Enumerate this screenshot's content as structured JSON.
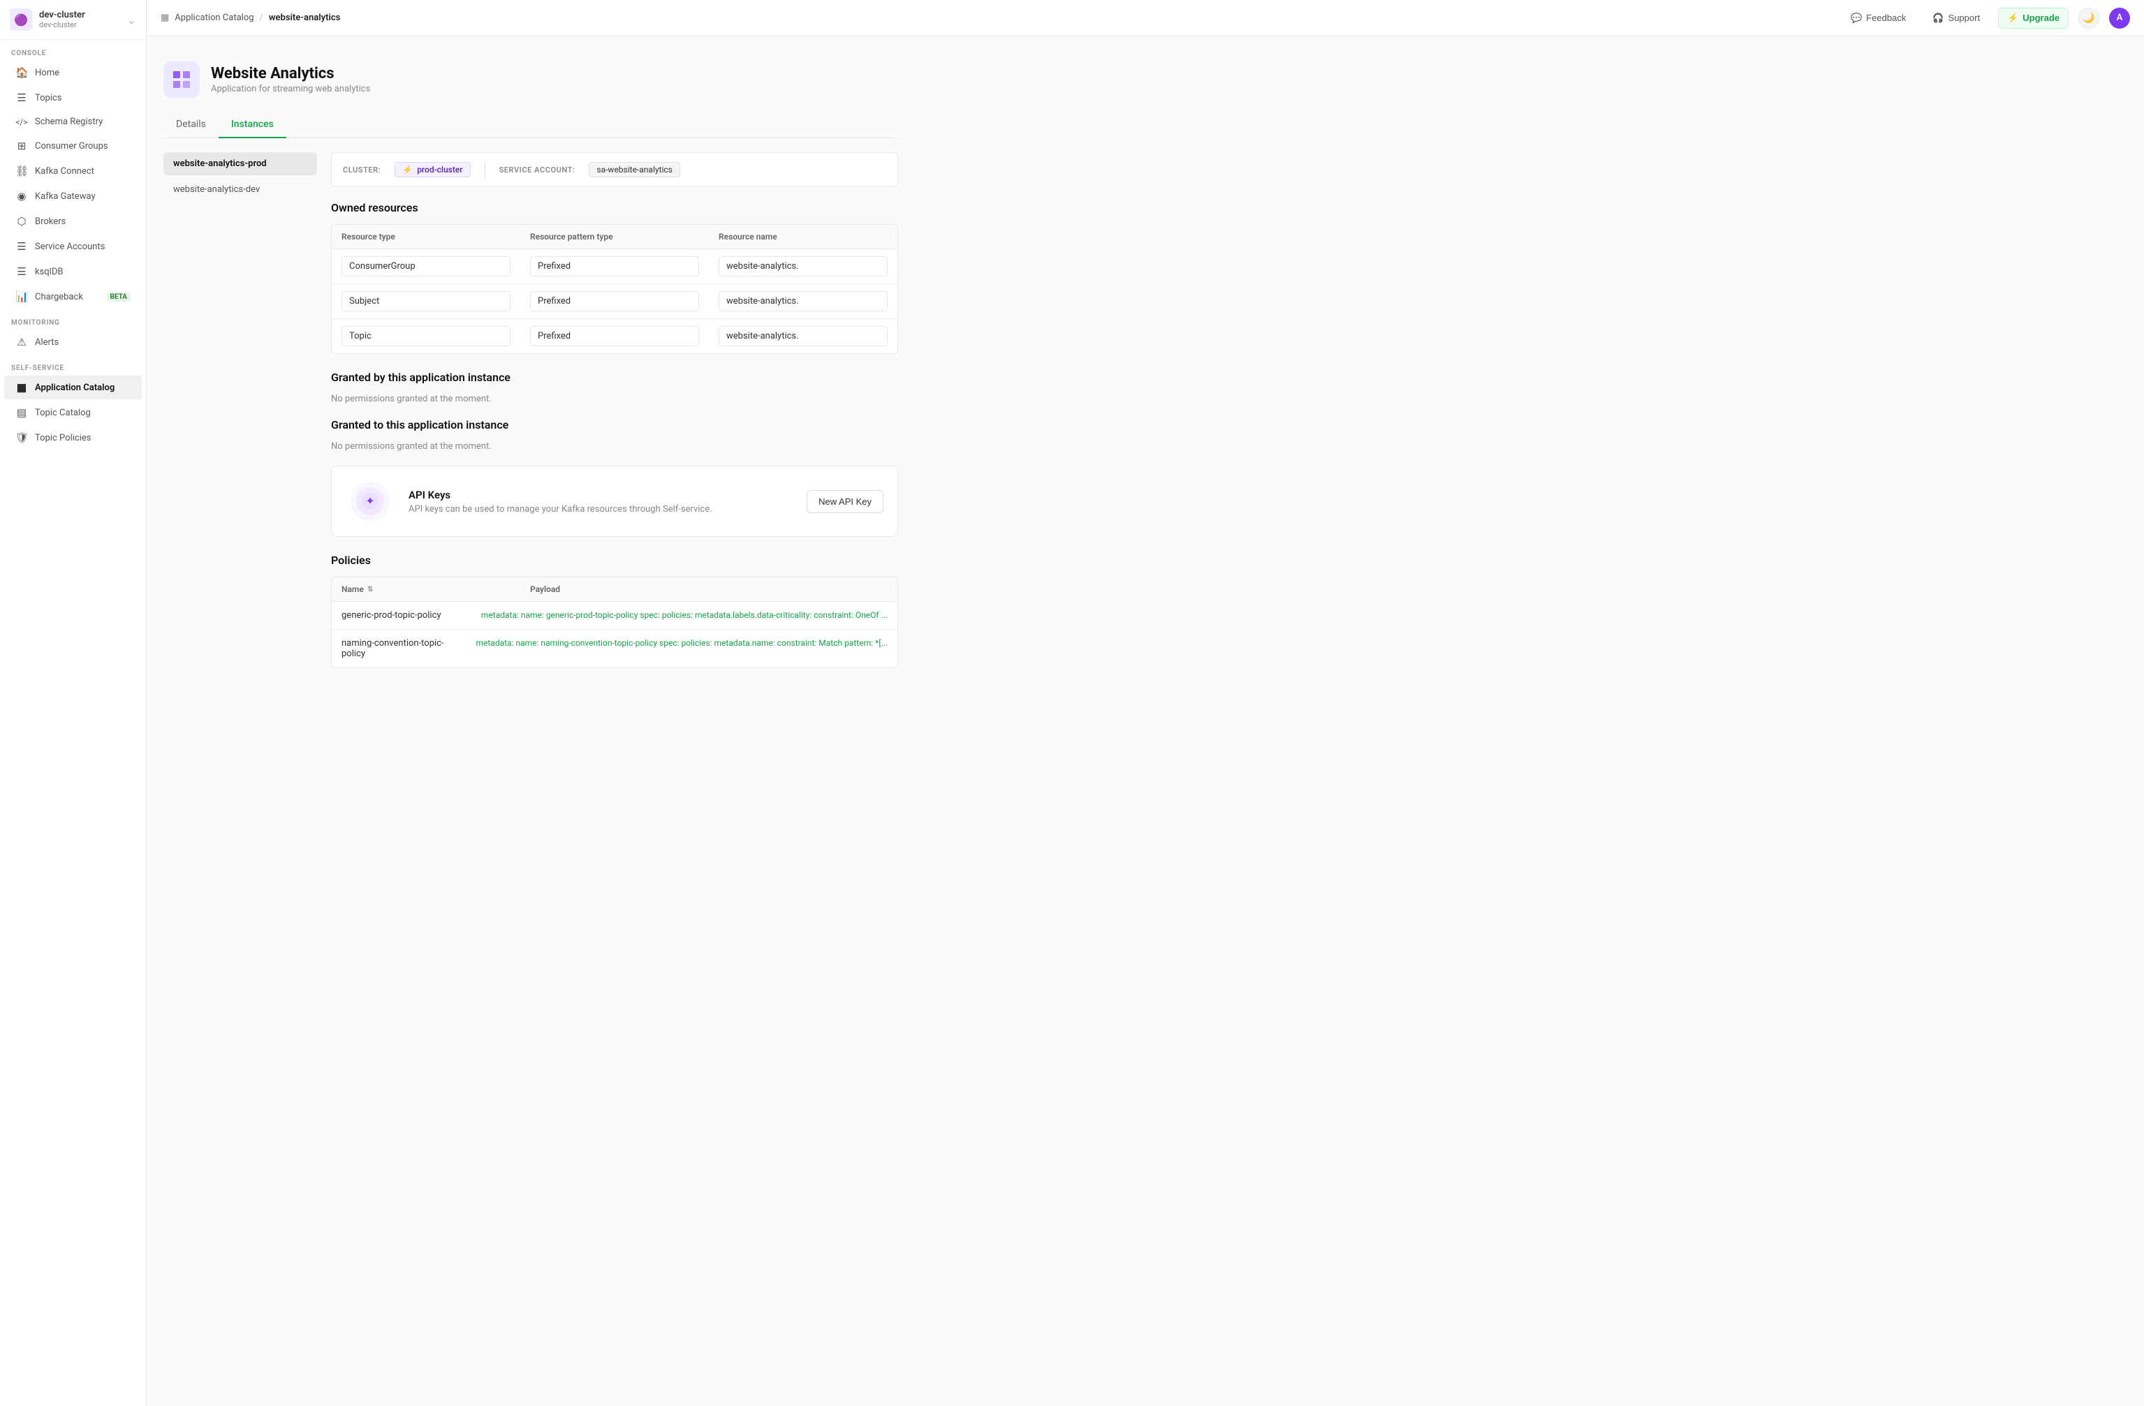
{
  "sidebar": {
    "cluster": {
      "name": "dev-cluster",
      "sub": "dev-cluster"
    },
    "console_label": "CONSOLE",
    "monitoring_label": "MONITORING",
    "selfservice_label": "SELF-SERVICE",
    "items_console": [
      {
        "id": "home",
        "label": "Home",
        "icon": "🏠"
      },
      {
        "id": "topics",
        "label": "Topics",
        "icon": "☰"
      },
      {
        "id": "schema-registry",
        "label": "Schema Registry",
        "icon": "⟨⟩"
      },
      {
        "id": "consumer-groups",
        "label": "Consumer Groups",
        "icon": "👥"
      },
      {
        "id": "kafka-connect",
        "label": "Kafka Connect",
        "icon": "⛓"
      },
      {
        "id": "kafka-gateway",
        "label": "Kafka Gateway",
        "icon": "⊙"
      },
      {
        "id": "brokers",
        "label": "Brokers",
        "icon": "⬡"
      },
      {
        "id": "service-accounts",
        "label": "Service Accounts",
        "icon": "☰"
      },
      {
        "id": "ksqldb",
        "label": "ksqlDB",
        "icon": "☰"
      },
      {
        "id": "chargeback",
        "label": "Chargeback",
        "icon": "📊",
        "beta": true
      }
    ],
    "items_monitoring": [
      {
        "id": "alerts",
        "label": "Alerts",
        "icon": "⚠"
      }
    ],
    "items_selfservice": [
      {
        "id": "application-catalog",
        "label": "Application Catalog",
        "icon": "▦",
        "active": true
      },
      {
        "id": "topic-catalog",
        "label": "Topic Catalog",
        "icon": "▤"
      },
      {
        "id": "topic-policies",
        "label": "Topic Policies",
        "icon": "🛡"
      }
    ]
  },
  "topbar": {
    "breadcrumb_link": "Application Catalog",
    "breadcrumb_sep": "/",
    "breadcrumb_current": "website-analytics",
    "feedback_label": "Feedback",
    "support_label": "Support",
    "upgrade_label": "Upgrade",
    "avatar_letter": "A"
  },
  "app": {
    "icon": "≡",
    "title": "Website Analytics",
    "subtitle": "Application for streaming web analytics"
  },
  "tabs": [
    {
      "id": "details",
      "label": "Details"
    },
    {
      "id": "instances",
      "label": "Instances",
      "active": true
    }
  ],
  "instances": {
    "sidebar_items": [
      {
        "id": "prod",
        "label": "website-analytics-prod",
        "active": true
      },
      {
        "id": "dev",
        "label": "website-analytics-dev"
      }
    ],
    "cluster_label": "CLUSTER:",
    "cluster_value": "prod-cluster",
    "sa_label": "SERVICE ACCOUNT:",
    "sa_value": "sa-website-analytics"
  },
  "owned_resources": {
    "title": "Owned resources",
    "columns": [
      "Resource type",
      "Resource pattern type",
      "Resource name"
    ],
    "rows": [
      {
        "type": "ConsumerGroup",
        "pattern": "Prefixed",
        "name": "website-analytics."
      },
      {
        "type": "Subject",
        "pattern": "Prefixed",
        "name": "website-analytics."
      },
      {
        "type": "Topic",
        "pattern": "Prefixed",
        "name": "website-analytics."
      }
    ]
  },
  "granted_by": {
    "title": "Granted by this application instance",
    "empty_text": "No permissions granted at the moment."
  },
  "granted_to": {
    "title": "Granted to this application instance",
    "empty_text": "No permissions granted at the moment."
  },
  "api_keys": {
    "title": "API Keys",
    "description": "API keys can be used to manage your Kafka resources through Self-service.",
    "button_label": "New API Key"
  },
  "policies": {
    "title": "Policies",
    "columns": [
      "Name",
      "Payload"
    ],
    "sort_icon": "⇅",
    "rows": [
      {
        "name": "generic-prod-topic-policy",
        "payload": "metadata: name: generic-prod-topic-policy spec: policies: metadata.labels.data-criticality: constraint: OneOf ..."
      },
      {
        "name": "naming-convention-topic-policy",
        "payload": "metadata: name: naming-convention-topic-policy spec: policies: metadata.name: constraint: Match pattern: *[..."
      }
    ]
  }
}
